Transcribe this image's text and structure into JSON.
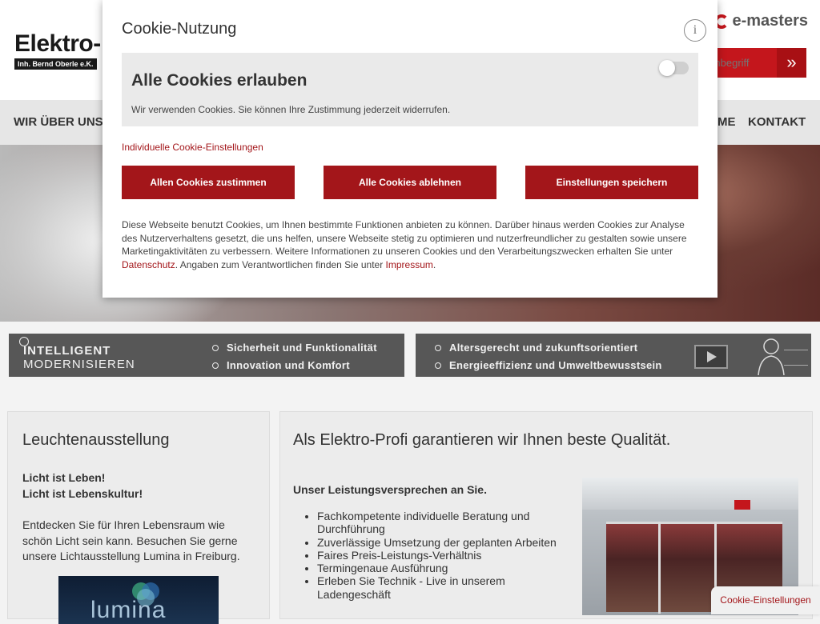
{
  "header": {
    "logo_main": "Elektro-",
    "logo_sub": "Inh. Bernd Oberle e.K.",
    "partner_logo": "e-masters",
    "search_placeholder": "Suchbegriff",
    "search_icon": "double-chevron-right-icon"
  },
  "nav": {
    "items": [
      "WIR ÜBER UNS",
      "ME",
      "KONTAKT"
    ]
  },
  "banners": {
    "left": {
      "title_line1": "INTELLIGENT",
      "title_line2": "MODERNISIEREN",
      "bullets": [
        "Sicherheit und Funktionalität",
        "Innovation und Komfort"
      ]
    },
    "right": {
      "bullets": [
        "Altersgerecht und zukunftsorientiert",
        "Energieeffizienz und Umweltbewusstsein"
      ]
    }
  },
  "left_panel": {
    "title": "Leuchtenausstellung",
    "bold_line1": "Licht ist Leben!",
    "bold_line2": "Licht ist Lebenskultur!",
    "text_line1": "Entdecken Sie für Ihren Lebensraum wie",
    "text_line2": "schön Licht sein kann. Besuchen Sie gerne",
    "text_line3": "unsere Lichtausstellung Lumina in Freiburg.",
    "image_text": "lumina"
  },
  "right_panel": {
    "title": "Als Elektro-Profi garantieren wir Ihnen beste Qualität.",
    "subtitle": "Unser Leistungsversprechen an Sie.",
    "services": [
      "Fachkompetente individuelle Beratung und Durchführung",
      "Zuverlässige Umsetzung der geplanten Arbeiten",
      "Faires Preis-Leistungs-Verhältnis",
      "Termingenaue Ausführung",
      "Erleben Sie Technik - Live in unserem Ladengeschäft"
    ]
  },
  "cookie_tab": {
    "label": "Cookie-Einstellungen"
  },
  "modal": {
    "title": "Cookie-Nutzung",
    "info_label": "i",
    "allow_title": "Alle Cookies erlauben",
    "allow_desc": "Wir verwenden Cookies. Sie können Ihre Zustimmung jederzeit widerrufen.",
    "toggle_on": false,
    "individual_link": "Individuelle Cookie-Einstellungen",
    "buttons": {
      "accept_all": "Allen Cookies zustimmen",
      "reject_all": "Alle Cookies ablehnen",
      "save": "Einstellungen speichern"
    },
    "text_part1": "Diese Webseite benutzt Cookies, um Ihnen bestimmte Funktionen anbieten zu können. Darüber hinaus werden Cookies zur Analyse des Nutzerverhaltens gesetzt, die uns helfen, unsere Webseite stetig zu optimieren und nutzerfreundlicher zu gestalten sowie unsere Marketingaktivitäten zu verbessern. Weitere Informationen zu unseren Cookies und den Verarbeitungszwecken erhalten Sie unter ",
    "link_privacy": "Datenschutz",
    "text_part2": ". Angaben zum Verantwortlichen finden Sie unter ",
    "link_imprint": "Impressum",
    "text_part3": "."
  },
  "colors": {
    "brand_red": "#a3161a",
    "nav_bg": "#e6e6e6",
    "banner_bg": "#575757"
  }
}
